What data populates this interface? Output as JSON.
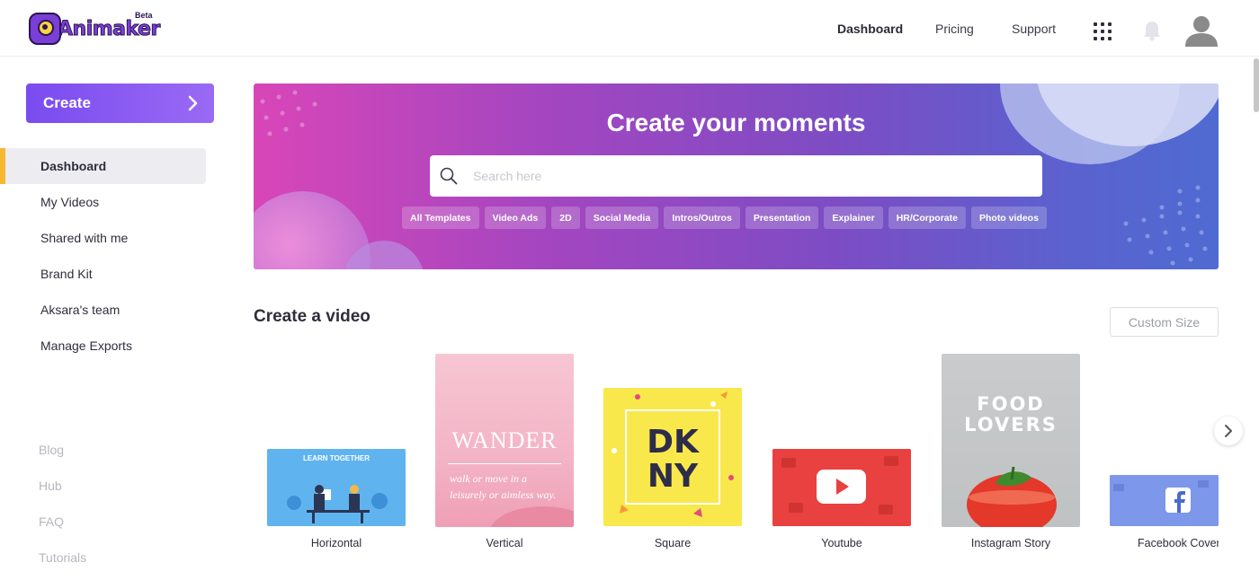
{
  "brand": {
    "name": "Animaker",
    "badge": "Beta"
  },
  "nav": {
    "dashboard": "Dashboard",
    "pricing": "Pricing",
    "support": "Support"
  },
  "sidebar": {
    "create_label": "Create",
    "items": [
      {
        "label": "Dashboard",
        "active": true
      },
      {
        "label": "My Videos"
      },
      {
        "label": "Shared with me"
      },
      {
        "label": "Brand Kit"
      },
      {
        "label": "Aksara's team"
      },
      {
        "label": "Manage Exports"
      }
    ],
    "secondary": [
      {
        "label": "Blog"
      },
      {
        "label": "Hub"
      },
      {
        "label": "FAQ"
      },
      {
        "label": "Tutorials"
      }
    ]
  },
  "hero": {
    "title": "Create your moments",
    "search_placeholder": "Search here",
    "chips": [
      "All Templates",
      "Video Ads",
      "2D",
      "Social Media",
      "Intros/Outros",
      "Presentation",
      "Explainer",
      "HR/Corporate",
      "Photo videos"
    ]
  },
  "section": {
    "title": "Create a video",
    "custom_size": "Custom Size",
    "cards": [
      {
        "label": "Horizontal",
        "art_text": "LEARN TOGETHER"
      },
      {
        "label": "Vertical",
        "art_title": "WANDER",
        "art_sub": "walk or move in a leisurely or aimless way."
      },
      {
        "label": "Square",
        "art_line1": "DK",
        "art_line2": "NY"
      },
      {
        "label": "Youtube"
      },
      {
        "label": "Instagram Story",
        "art_line1": "FOOD",
        "art_line2": "LOVERS"
      },
      {
        "label": "Facebook Cover"
      }
    ]
  },
  "colors": {
    "accent": "#7a4bef",
    "active_indicator": "#f5b82e",
    "hero_start": "#d846b8",
    "hero_end": "#4f6bd2"
  }
}
